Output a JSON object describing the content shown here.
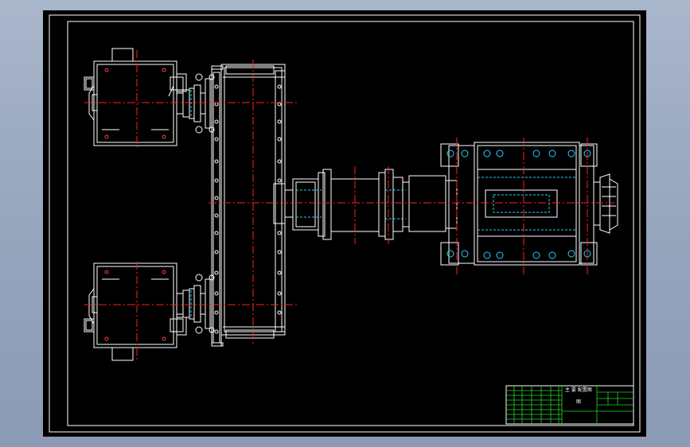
{
  "drawing": {
    "background": "#000000",
    "frame_color": "#ffffff",
    "outline_color": "#ffffff",
    "centerline_color": "#ff2020",
    "hidden_line_color": "#28d0ff",
    "title_block_grid_color": "#22dd22",
    "components": [
      {
        "name": "upper-gear-motor",
        "icon": "gearbox-symbol"
      },
      {
        "name": "lower-gear-motor",
        "icon": "gearbox-symbol"
      },
      {
        "name": "upper-coupling",
        "icon": "coupling-symbol"
      },
      {
        "name": "lower-coupling",
        "icon": "coupling-symbol"
      },
      {
        "name": "vertical-frame",
        "icon": "frame-symbol"
      },
      {
        "name": "drive-drum",
        "icon": "drum-symbol"
      },
      {
        "name": "bearing-housing",
        "icon": "housing-symbol"
      },
      {
        "name": "end-cap",
        "icon": "cap-symbol"
      }
    ]
  },
  "title_block": {
    "title_text": "主 要 配置图",
    "drawing_no": "图"
  }
}
